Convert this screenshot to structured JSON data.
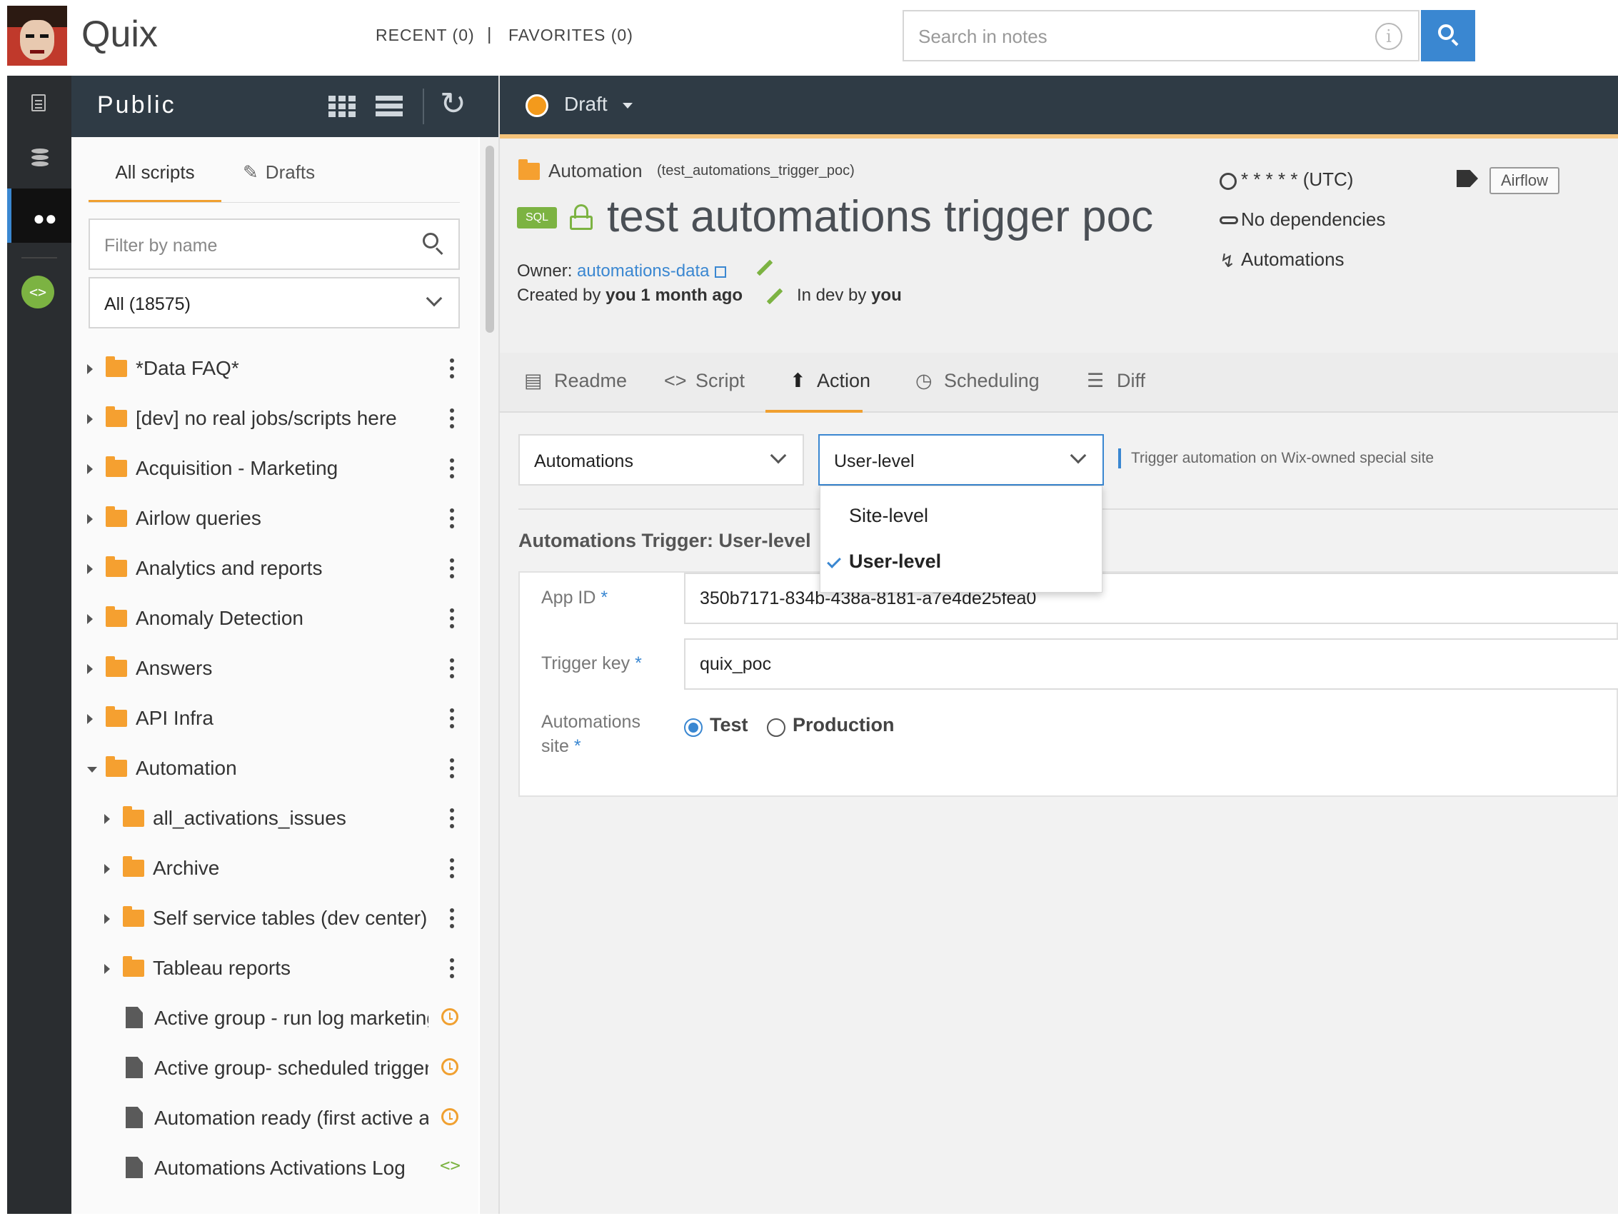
{
  "app": {
    "title": "Quix"
  },
  "topnav": {
    "recent": "RECENT (0)",
    "separator": "|",
    "favorites": "FAVORITES (0)"
  },
  "search": {
    "placeholder": "Search in notes",
    "info_glyph": "i"
  },
  "rail": {
    "items": [
      "notes-icon",
      "database-icon",
      "people-icon"
    ],
    "active": "people-icon",
    "code_glyph": "<>"
  },
  "left": {
    "title": "Public",
    "tabs": {
      "all": "All scripts",
      "drafts": "Drafts"
    },
    "filter_placeholder": "Filter by name",
    "scope_value": "All (18575)",
    "tree": [
      {
        "type": "folder",
        "label": "*Data FAQ*",
        "depth": 0,
        "expanded": false
      },
      {
        "type": "folder",
        "label": "[dev] no real jobs/scripts here",
        "depth": 0,
        "expanded": false
      },
      {
        "type": "folder",
        "label": "Acquisition - Marketing",
        "depth": 0,
        "expanded": false
      },
      {
        "type": "folder",
        "label": "Airlow queries",
        "depth": 0,
        "expanded": false
      },
      {
        "type": "folder",
        "label": "Analytics and reports",
        "depth": 0,
        "expanded": false
      },
      {
        "type": "folder",
        "label": "Anomaly Detection",
        "depth": 0,
        "expanded": false
      },
      {
        "type": "folder",
        "label": "Answers",
        "depth": 0,
        "expanded": false
      },
      {
        "type": "folder",
        "label": "API Infra",
        "depth": 0,
        "expanded": false
      },
      {
        "type": "folder",
        "label": "Automation",
        "depth": 0,
        "expanded": true
      },
      {
        "type": "folder",
        "label": "all_activations_issues",
        "depth": 1,
        "expanded": false
      },
      {
        "type": "folder",
        "label": "Archive",
        "depth": 1,
        "expanded": false
      },
      {
        "type": "folder",
        "label": "Self service tables (dev center)",
        "depth": 1,
        "expanded": false
      },
      {
        "type": "folder",
        "label": "Tableau reports",
        "depth": 1,
        "expanded": false
      },
      {
        "type": "file",
        "label": "Active group - run log marketing",
        "depth": 1,
        "badge": "alarm-icon"
      },
      {
        "type": "file",
        "label": "Active group- scheduled trigger",
        "depth": 1,
        "badge": "alarm-icon"
      },
      {
        "type": "file",
        "label": "Automation ready (first active a",
        "depth": 1,
        "badge": "alarm-icon"
      },
      {
        "type": "file",
        "label": "Automations Activations Log",
        "depth": 1,
        "badge": "code-icon"
      }
    ]
  },
  "status": {
    "label": "Draft",
    "color": "#f39a1c"
  },
  "script": {
    "folder": "Automation",
    "slug": "(test_automations_trigger_poc)",
    "type_badge": "SQL",
    "title": "test automations trigger poc",
    "owner_label": "Owner:",
    "owner": "automations-data",
    "created_prefix": "Created by",
    "created_by": "you",
    "created_when": "1 month ago",
    "indev_prefix": "In dev by",
    "indev_by": "you",
    "schedule": "* * * * * (UTC)",
    "dependencies": "No dependencies",
    "trigger": "Automations",
    "tag": "Airflow"
  },
  "tabs": [
    "Readme",
    "Script",
    "Action",
    "Scheduling",
    "Diff"
  ],
  "active_tab": "Action",
  "action": {
    "type_select": "Automations",
    "level_select": "User-level",
    "hint": "Trigger automation on Wix-owned special site",
    "section_title": "Automations Trigger: User-level",
    "fields": {
      "app_id_label": "App ID",
      "app_id_value": "350b7171-834b-438a-8181-a7e4de25fea0",
      "trigger_key_label": "Trigger key",
      "trigger_key_value": "quix_poc",
      "site_label_1": "Automations",
      "site_label_2": "site",
      "required_mark": "*"
    },
    "site_options": [
      "Test",
      "Production"
    ],
    "site_selected": "Test",
    "dropdown": {
      "options": [
        "Site-level",
        "User-level"
      ],
      "selected": "User-level"
    }
  },
  "colors": {
    "accent": "#3a87d1",
    "header": "#2f3b45",
    "folder": "#f5a030",
    "green": "#7cb342"
  }
}
